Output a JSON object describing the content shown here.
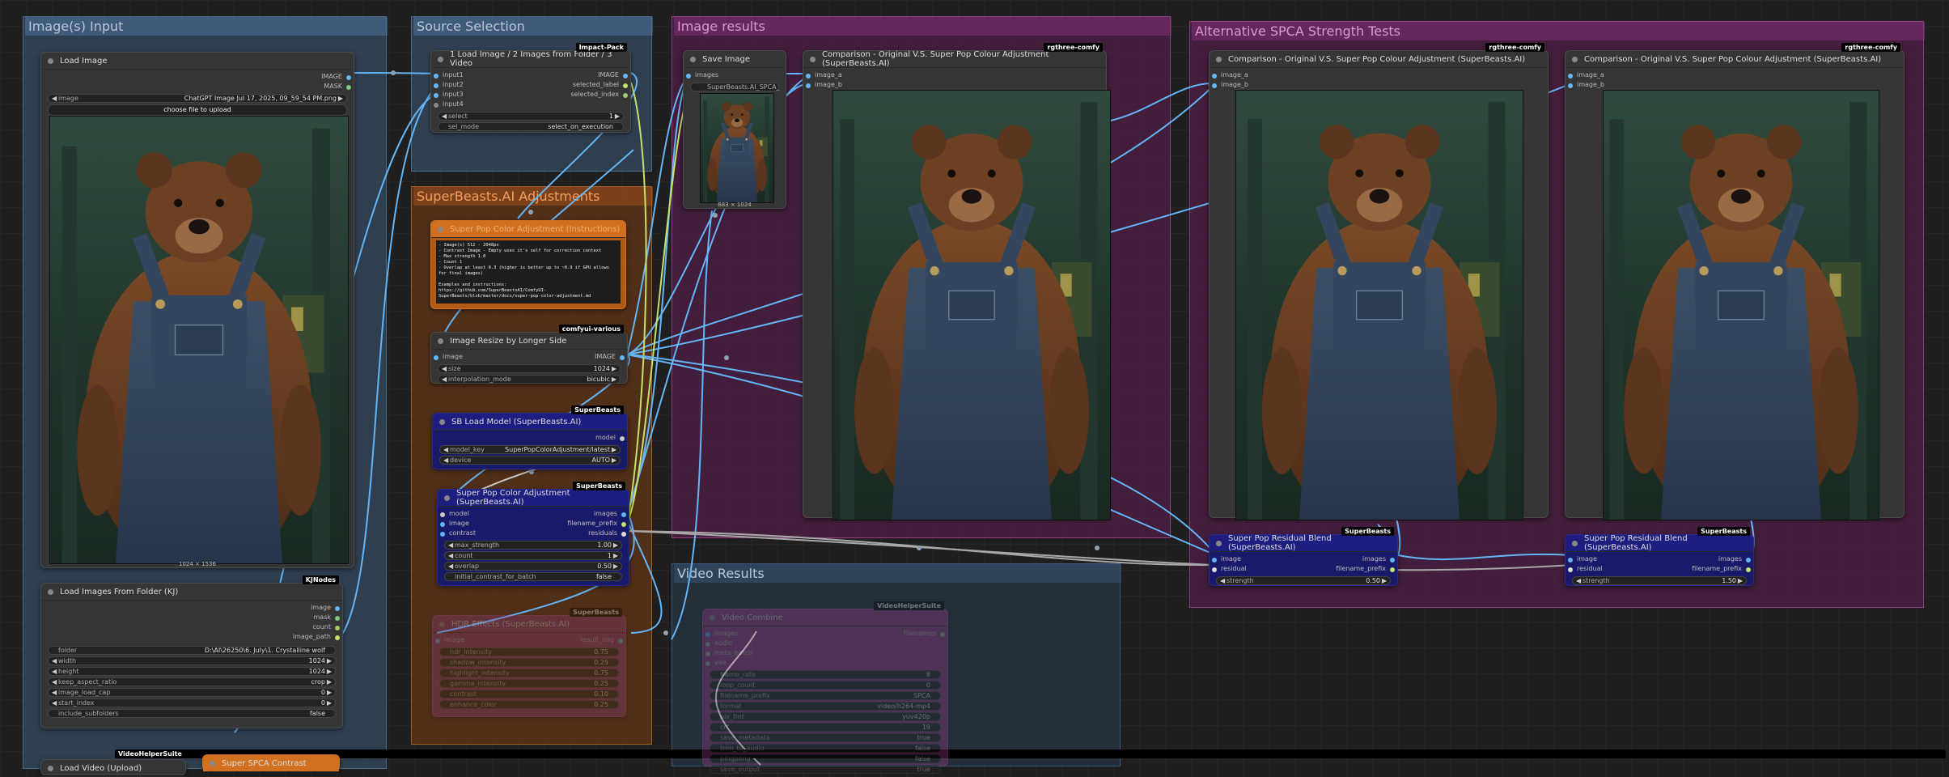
{
  "groups": {
    "images_input": "Image(s) Input",
    "source_selection": "Source Selection",
    "adjustments": "SuperBeasts.AI Adjustments",
    "image_results": "Image results",
    "alt_tests": "Alternative SPCA Strength Tests",
    "video_results": "Video Results"
  },
  "load_image": {
    "title": "Load Image",
    "out_image": "IMAGE",
    "out_mask": "MASK",
    "image_label": "image",
    "image_value": "ChatGPT Image Jul 17, 2025, 09_59_54 PM.png",
    "upload_label": "choose file to upload",
    "caption": "1024 × 1536"
  },
  "load_folder": {
    "title": "Load Images From Folder (KJ)",
    "badge": "KJNodes",
    "outs": [
      "image",
      "mask",
      "count",
      "image_path"
    ],
    "widgets": [
      {
        "label": "folder",
        "value": "D:\\AI\\26250\\6. July\\1. Crystalline wolf"
      },
      {
        "label": "width",
        "value": "1024"
      },
      {
        "label": "height",
        "value": "1024"
      },
      {
        "label": "keep_aspect_ratio",
        "value": "crop"
      },
      {
        "label": "image_load_cap",
        "value": "0"
      },
      {
        "label": "start_index",
        "value": "0"
      },
      {
        "label": "include_subfolders",
        "value": "false"
      }
    ]
  },
  "bottom_nodes": {
    "video_badge": "VideoHelperSuite",
    "load_video": "Load Video (Upload)",
    "spca_contrast": "Super SPCA Contrast"
  },
  "selector": {
    "title": "1 Load Image / 2 Images from Folder / 3 Video",
    "badge": "Impact-Pack",
    "ins": [
      "input1",
      "input2",
      "input3",
      "input4"
    ],
    "outs": [
      "IMAGE",
      "selected_label",
      "selected_index"
    ],
    "select_label": "select",
    "select_value": "1",
    "sel_mode_label": "sel_mode",
    "sel_mode_value": "select_on_execution"
  },
  "note": {
    "title": "Super Pop Color Adjustment (Instructions)",
    "text": "- Image(s) 512 - 2048px\n- Contrast Image - Empty uses it's self for correction context\n- Max strength 1.0\n- Count 1\n- Overlap at least 0.3 (higher is better up to ~0.9 if GPU allows for final images)\n\nExamples and instructions:\nhttps://github.com/SuperBeastsAI/ComfyUI-SuperBeasts/blob/master/docs/super-pop-color-adjustment.md"
  },
  "resize": {
    "title": "Image Resize by Longer Side",
    "badge": "comfyui-various",
    "in": "image",
    "out": "IMAGE",
    "size_label": "size",
    "size_value": "1024",
    "interp_label": "interpolation_mode",
    "interp_value": "bicubic"
  },
  "sb_load": {
    "title": "SB Load Model (SuperBeasts.AI)",
    "badge": "SuperBeasts",
    "out": "model",
    "model_key_label": "model_key",
    "model_key_value": "SuperPopColorAdjustment/latest",
    "device_label": "device",
    "device_value": "AUTO"
  },
  "spca": {
    "title": "Super Pop Color Adjustment (SuperBeasts.AI)",
    "badge": "SuperBeasts",
    "ins": [
      "model",
      "image",
      "contrast"
    ],
    "outs": [
      "images",
      "filename_prefix",
      "residuals"
    ],
    "widgets": [
      {
        "label": "max_strength",
        "value": "1.00"
      },
      {
        "label": "count",
        "value": "1"
      },
      {
        "label": "overlap",
        "value": "0.50"
      },
      {
        "label": "initial_contrast_for_batch",
        "value": "false"
      }
    ]
  },
  "hdr": {
    "title": "HDR Effects (SuperBeasts.AI)",
    "badge": "SuperBeasts",
    "in": "image",
    "out": "result_img",
    "widgets": [
      {
        "label": "hdr_intensity",
        "value": "0.75"
      },
      {
        "label": "shadow_intensity",
        "value": "0.25"
      },
      {
        "label": "highlight_intensity",
        "value": "0.75"
      },
      {
        "label": "gamma_intensity",
        "value": "0.25"
      },
      {
        "label": "contrast",
        "value": "0.10"
      },
      {
        "label": "enhance_color",
        "value": "0.25"
      }
    ]
  },
  "save_image": {
    "title": "Save Image",
    "in": "images",
    "prefix": "SuperBeasts.AI_SPCA_",
    "caption": "683 × 1024"
  },
  "comparisons": [
    {
      "title": "Comparison - Original V.S. Super Pop Colour Adjustment (SuperBeasts.AI)",
      "badge": "rgthree-comfy",
      "in_a": "image_a",
      "in_b": "image_b"
    },
    {
      "title": "Comparison - Original V.S. Super Pop Colour Adjustment (SuperBeasts.AI)",
      "badge": "rgthree-comfy",
      "in_a": "image_a",
      "in_b": "image_b"
    },
    {
      "title": "Comparison - Original V.S. Super Pop Colour Adjustment (SuperBeasts.AI)",
      "badge": "rgthree-comfy",
      "in_a": "image_a",
      "in_b": "image_b"
    }
  ],
  "blends": [
    {
      "title": "Super Pop Residual Blend (SuperBeasts.AI)",
      "badge": "SuperBeasts",
      "ins": [
        "image",
        "residual"
      ],
      "outs": [
        "images",
        "filename_prefix"
      ],
      "strength_label": "strength",
      "strength_value": "0.50"
    },
    {
      "title": "Super Pop Residual Blend (SuperBeasts.AI)",
      "badge": "SuperBeasts",
      "ins": [
        "image",
        "residual"
      ],
      "outs": [
        "images",
        "filename_prefix"
      ],
      "strength_label": "strength",
      "strength_value": "1.50"
    }
  ],
  "video_combine": {
    "title": "Video Combine",
    "badge": "VideoHelperSuite",
    "ins": [
      "images",
      "audio",
      "meta_batch",
      "vae"
    ],
    "out": "Filenames",
    "widgets": [
      {
        "label": "frame_rate",
        "value": "8"
      },
      {
        "label": "loop_count",
        "value": "0"
      },
      {
        "label": "filename_prefix",
        "value": "SPCA"
      },
      {
        "label": "format",
        "value": "video/h264-mp4"
      },
      {
        "label": "pix_fmt",
        "value": "yuv420p"
      },
      {
        "label": "crf",
        "value": "19"
      },
      {
        "label": "save_metadata",
        "value": "true"
      },
      {
        "label": "trim_to_audio",
        "value": "false"
      },
      {
        "label": "pingpong",
        "value": "false"
      },
      {
        "label": "save_output",
        "value": "true"
      }
    ]
  },
  "colors": {
    "image_wire": "#64b5f6",
    "mask_wire": "#81c784",
    "string_wire": "#c5e16b",
    "residual_wire": "#a8a8a8",
    "group_blue": "#3c5a78",
    "group_orange": "#a0602a",
    "group_purple": "#904080"
  }
}
